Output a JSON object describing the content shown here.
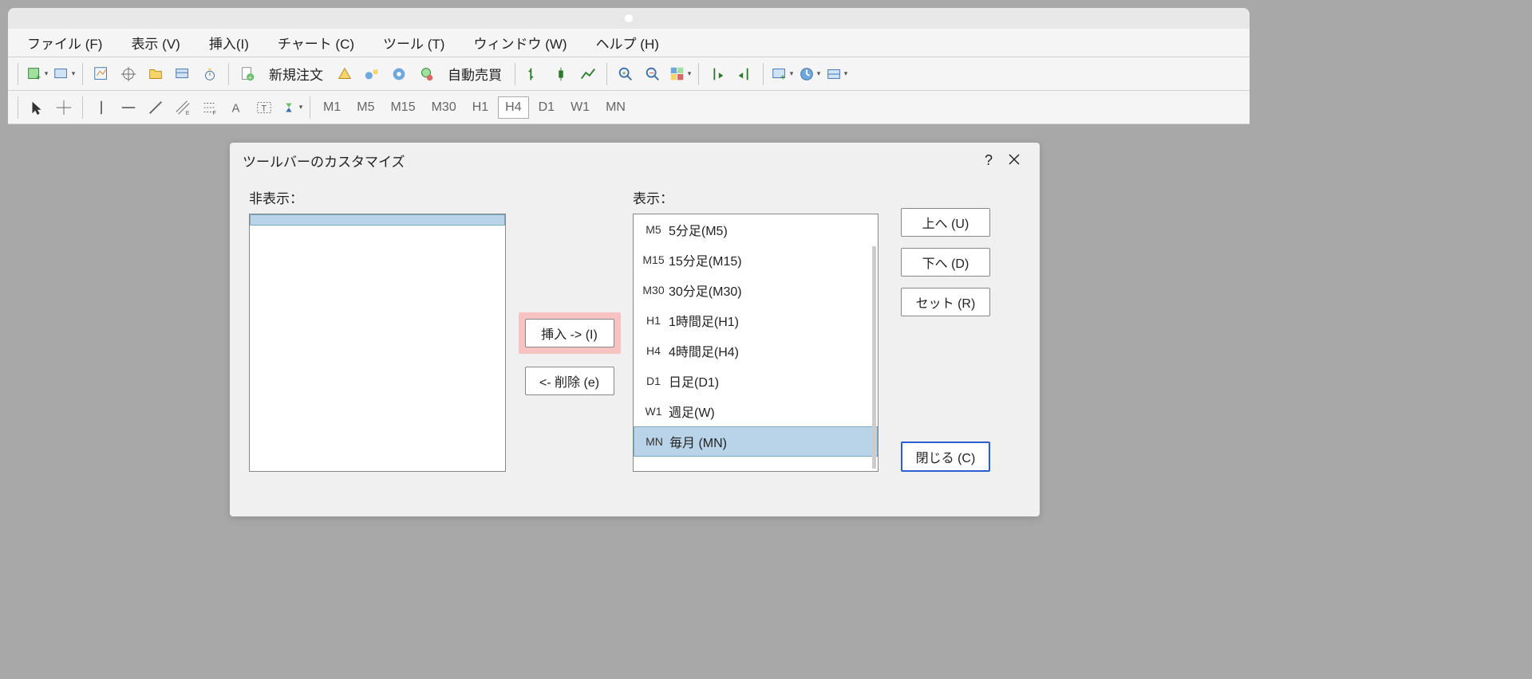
{
  "menubar": {
    "file": "ファイル (F)",
    "view": "表示 (V)",
    "insert": "挿入(I)",
    "chart": "チャート (C)",
    "tools": "ツール (T)",
    "window": "ウィンドウ (W)",
    "help": "ヘルプ (H)"
  },
  "toolbar": {
    "new_order": "新規注文",
    "auto_trade": "自動売買"
  },
  "timeframes": [
    "M1",
    "M5",
    "M15",
    "M30",
    "H1",
    "H4",
    "D1",
    "W1",
    "MN"
  ],
  "timeframe_active": "H4",
  "dialog": {
    "title": "ツールバーのカスタマイズ",
    "help_symbol": "?",
    "labels": {
      "hidden": "非表示：",
      "shown": "表示："
    },
    "buttons": {
      "insert": "挿入 -> (I)",
      "remove": "<- 削除 (e)",
      "up": "上へ (U)",
      "down": "下へ (D)",
      "reset": "セット (R)",
      "close": "閉じる (C)"
    },
    "shown_items": [
      {
        "code": "M5",
        "label": "5分足(M5)"
      },
      {
        "code": "M15",
        "label": "15分足(M15)"
      },
      {
        "code": "M30",
        "label": "30分足(M30)"
      },
      {
        "code": "H1",
        "label": "1時間足(H1)"
      },
      {
        "code": "H4",
        "label": "4時間足(H4)"
      },
      {
        "code": "D1",
        "label": "日足(D1)"
      },
      {
        "code": "W1",
        "label": "週足(W)"
      },
      {
        "code": "MN",
        "label": "毎月 (MN)"
      }
    ],
    "shown_selected_index": 7
  }
}
